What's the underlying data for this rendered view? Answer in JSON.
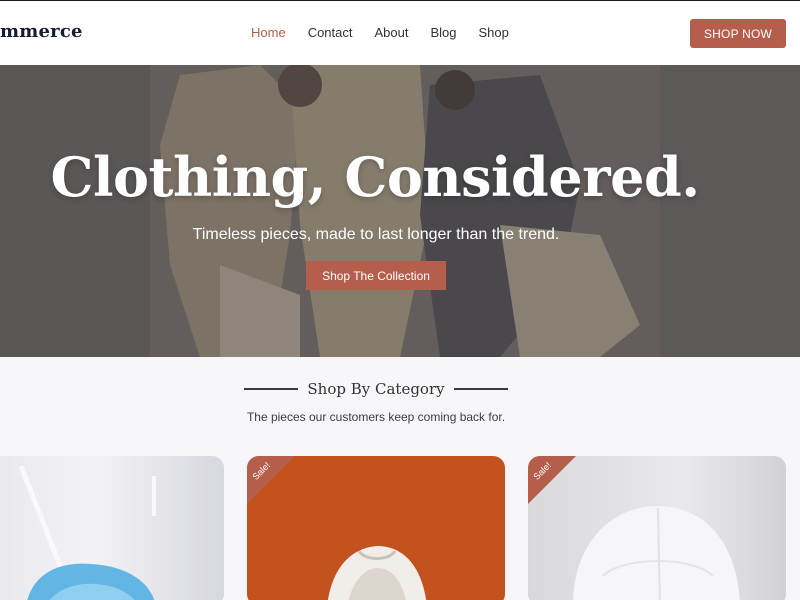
{
  "header": {
    "logo": "mmerce",
    "nav": [
      "Home",
      "Contact",
      "About",
      "Blog",
      "Shop"
    ],
    "active_nav": "Home",
    "cta": "SHOP NOW"
  },
  "hero": {
    "title": "Clothing, Considered.",
    "subtitle": "Timeless pieces, made to last longer than the trend.",
    "button": "Shop The Collection"
  },
  "categories": {
    "title": "Shop By Category",
    "subtitle": "The pieces our customers keep coming back for.",
    "badge": "Sale!"
  },
  "colors": {
    "accent": "#b65e4c",
    "logo": "#141b33",
    "card_orange": "#c4521f"
  }
}
